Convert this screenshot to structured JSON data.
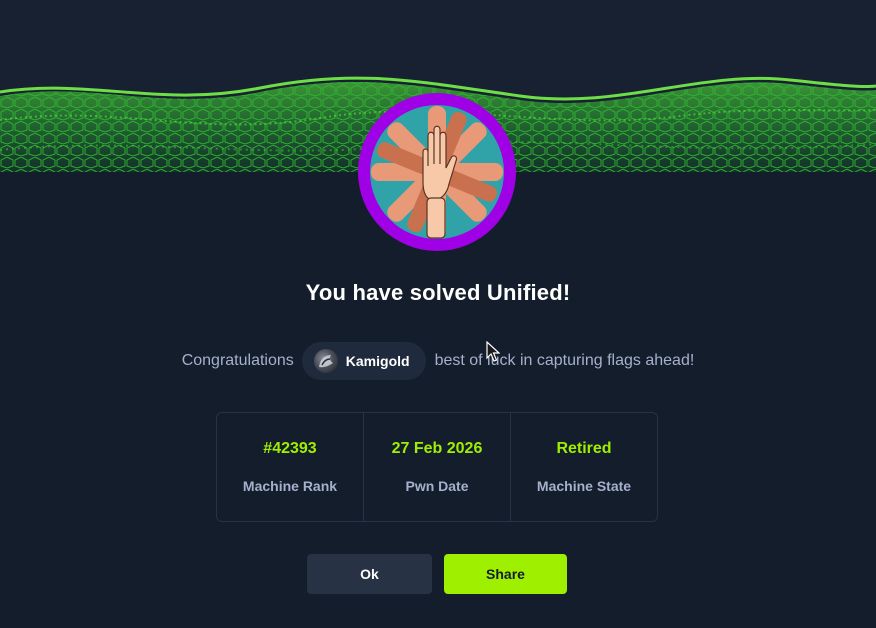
{
  "title": "You have solved Unified!",
  "congrats": {
    "prefix": "Congratulations",
    "username": "Kamigold",
    "suffix": "best of luck in capturing flags ahead!"
  },
  "stats": [
    {
      "value": "#42393",
      "label": "Machine Rank"
    },
    {
      "value": "27 Feb 2026",
      "label": "Pwn Date"
    },
    {
      "value": "Retired",
      "label": "Machine State"
    }
  ],
  "buttons": {
    "ok": "Ok",
    "share": "Share"
  },
  "colors": {
    "background": "#141d2b",
    "accent": "#9fef00",
    "muted": "#a4b1cd",
    "badge_ring": "#9f00e6"
  },
  "icons": {
    "badge": "unified-hands-icon",
    "avatar": "user-avatar"
  }
}
